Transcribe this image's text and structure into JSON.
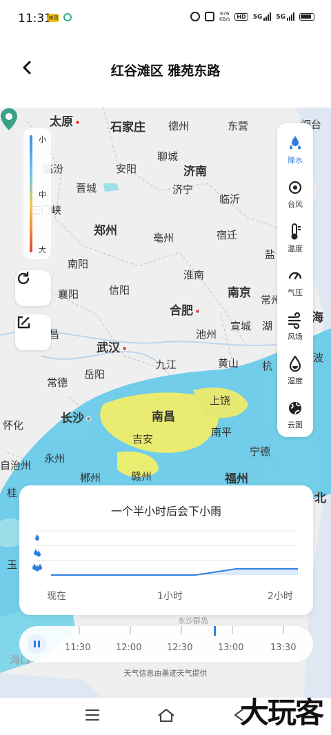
{
  "status_bar": {
    "time": "11:31",
    "notif_badge": "美团",
    "net_speed_value": "676",
    "net_speed_unit": "KB/s",
    "hd_label": "HD",
    "sim1_label": "5G",
    "sim2_label": "5G"
  },
  "header": {
    "title": "红谷滩区 雅苑东路"
  },
  "legend": {
    "low": "小",
    "mid": "中",
    "high": "大"
  },
  "map": {
    "cities": [
      {
        "name": "太原",
        "big": true
      },
      {
        "name": "石家庄",
        "big": true
      },
      {
        "name": "德州",
        "big": false
      },
      {
        "name": "东营",
        "big": false
      },
      {
        "name": "烟台",
        "big": false
      },
      {
        "name": "临汾",
        "big": false
      },
      {
        "name": "安阳",
        "big": false
      },
      {
        "name": "聊城",
        "big": false
      },
      {
        "name": "济南",
        "big": true
      },
      {
        "name": "晋城",
        "big": false
      },
      {
        "name": "济宁",
        "big": false
      },
      {
        "name": "临沂",
        "big": false
      },
      {
        "name": "三门峡",
        "big": false
      },
      {
        "name": "郑州",
        "big": true
      },
      {
        "name": "亳州",
        "big": false
      },
      {
        "name": "宿迁",
        "big": false
      },
      {
        "name": "南阳",
        "big": false
      },
      {
        "name": "淮南",
        "big": false
      },
      {
        "name": "盐",
        "big": false
      },
      {
        "name": "襄阳",
        "big": false
      },
      {
        "name": "信阳",
        "big": false
      },
      {
        "name": "南京",
        "big": true
      },
      {
        "name": "常州",
        "big": false
      },
      {
        "name": "合肥",
        "big": true
      },
      {
        "name": "宣城",
        "big": false
      },
      {
        "name": "海",
        "big": true
      },
      {
        "name": "宜昌",
        "big": false
      },
      {
        "name": "武汉",
        "big": true
      },
      {
        "name": "池州",
        "big": false
      },
      {
        "name": "湖",
        "big": false
      },
      {
        "name": "九江",
        "big": false
      },
      {
        "name": "黄山",
        "big": false
      },
      {
        "name": "杭",
        "big": false
      },
      {
        "name": "波",
        "big": false
      },
      {
        "name": "常德",
        "big": false
      },
      {
        "name": "岳阳",
        "big": false
      },
      {
        "name": "怀化",
        "big": false
      },
      {
        "name": "长沙",
        "big": true
      },
      {
        "name": "南昌",
        "big": true
      },
      {
        "name": "上饶",
        "big": false
      },
      {
        "name": "吉安",
        "big": false
      },
      {
        "name": "南平",
        "big": false
      },
      {
        "name": "永州",
        "big": false
      },
      {
        "name": "宁德",
        "big": false
      },
      {
        "name": "自治州",
        "big": false
      },
      {
        "name": "郴州",
        "big": false
      },
      {
        "name": "赣州",
        "big": false
      },
      {
        "name": "福州",
        "big": true
      },
      {
        "name": "桂",
        "big": false
      },
      {
        "name": "北",
        "big": false
      },
      {
        "name": "玉",
        "big": false
      },
      {
        "name": "东沙群岛",
        "big": false
      },
      {
        "name": "海口",
        "big": false
      }
    ],
    "refresh_icon": "refresh-icon",
    "edit_icon": "edit-icon",
    "location": "location-pin-icon"
  },
  "layers": [
    {
      "label": "降水",
      "icon": "precipitation-icon",
      "active": true
    },
    {
      "label": "台风",
      "icon": "typhoon-icon",
      "active": false
    },
    {
      "label": "温度",
      "icon": "thermometer-icon",
      "active": false
    },
    {
      "label": "气压",
      "icon": "gauge-icon",
      "active": false
    },
    {
      "label": "风场",
      "icon": "wind-icon",
      "active": false
    },
    {
      "label": "湿度",
      "icon": "humidity-icon",
      "active": false
    },
    {
      "label": "云图",
      "icon": "globe-icon",
      "active": false
    }
  ],
  "forecast": {
    "title": "一个半小时后会下小雨",
    "x_ticks": [
      "现在",
      "1小时",
      "2小时"
    ],
    "chart_data": {
      "type": "line",
      "title": "一个半小时后会下小雨",
      "x": [
        "现在",
        "1小时",
        "2小时"
      ],
      "intensity_levels": [
        "小",
        "中",
        "大"
      ],
      "series": [
        {
          "values_by_minute": [
            [
              0,
              0
            ],
            [
              70,
              0
            ],
            [
              75,
              0.1
            ],
            [
              90,
              0.42
            ],
            [
              120,
              0.42
            ]
          ]
        }
      ],
      "ylim": [
        0,
        3
      ],
      "grid": true
    }
  },
  "timeline": {
    "times": [
      "11:30",
      "12:00",
      "12:30",
      "13:00",
      "13:30"
    ],
    "progress": 0.74
  },
  "provider_text": "天气信息由墨迹天气提供",
  "watermark": "大玩客",
  "colors": {
    "accent": "#2e7fe0",
    "rain_light": "#5cc8e8",
    "rain_medium": "#f3e14a",
    "city_dot": "#e24a4a"
  }
}
